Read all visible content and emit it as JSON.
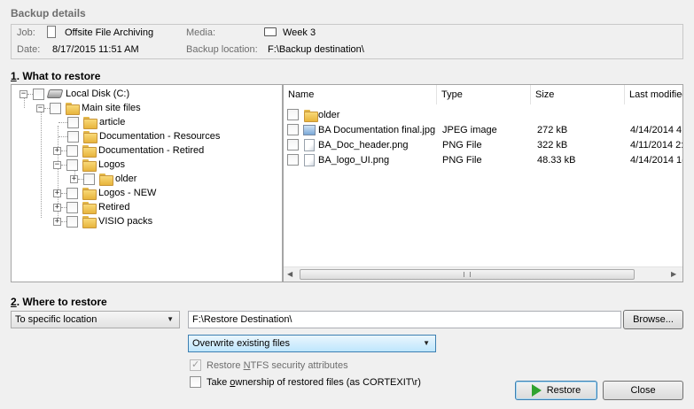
{
  "backup_details": {
    "title": "Backup details",
    "job_label": "Job:",
    "job_value": "Offsite File Archiving",
    "date_label": "Date:",
    "date_value": "8/17/2015 11:51 AM",
    "media_label": "Media:",
    "media_value": "Week 3",
    "location_label": "Backup location:",
    "location_value": "F:\\Backup destination\\"
  },
  "what_to_restore": {
    "number": "1",
    "title": ". What to restore",
    "tree": [
      {
        "label": "Local Disk (C:)",
        "expander": "−"
      },
      {
        "label": "Main site files",
        "expander": "−"
      },
      {
        "label": "article",
        "expander": ""
      },
      {
        "label": "Documentation - Resources",
        "expander": ""
      },
      {
        "label": "Documentation - Retired",
        "expander": "+"
      },
      {
        "label": "Logos",
        "expander": "−"
      },
      {
        "label": "older",
        "expander": "+"
      },
      {
        "label": "Logos - NEW",
        "expander": "+"
      },
      {
        "label": "Retired",
        "expander": "+"
      },
      {
        "label": "VISIO packs",
        "expander": "+"
      }
    ],
    "columns": [
      "Name",
      "Type",
      "Size",
      "Last modified"
    ],
    "files": [
      {
        "name": "older",
        "type": "",
        "size": "",
        "modified": "",
        "icon": "folder-icon"
      },
      {
        "name": "BA Documentation final.jpg",
        "type": "JPEG image",
        "size": "272 kB",
        "modified": "4/14/2014 4:",
        "icon": "jpeg-file-icon"
      },
      {
        "name": "BA_Doc_header.png",
        "type": "PNG File",
        "size": "322 kB",
        "modified": "4/11/2014 2:",
        "icon": "png-file-icon"
      },
      {
        "name": "BA_logo_UI.png",
        "type": "PNG File",
        "size": "48.33 kB",
        "modified": "4/14/2014 1(",
        "icon": "png-file-icon"
      }
    ]
  },
  "where_to_restore": {
    "number": "2",
    "title": ". Where to restore",
    "location_mode": "To specific location",
    "destination_path": "F:\\Restore Destination\\",
    "browse_label": "Browse...",
    "overwrite_mode": "Overwrite existing files",
    "ntfs_label_pre": "Restore ",
    "ntfs_label_key": "N",
    "ntfs_label_post": "TFS security attributes",
    "ntfs_checked": true,
    "ntfs_enabled": false,
    "ownership_label_pre": "Take ",
    "ownership_label_key": "o",
    "ownership_label_post": "wnership of restored files (as CORTEXIT\\r)",
    "ownership_checked": false
  },
  "buttons": {
    "restore_label": "Restore",
    "close_label": "Close"
  },
  "colors": {
    "window_bg": "#f0f0f0",
    "panel_border": "#a5a5a5",
    "restore_icon": "#2fa32f"
  }
}
